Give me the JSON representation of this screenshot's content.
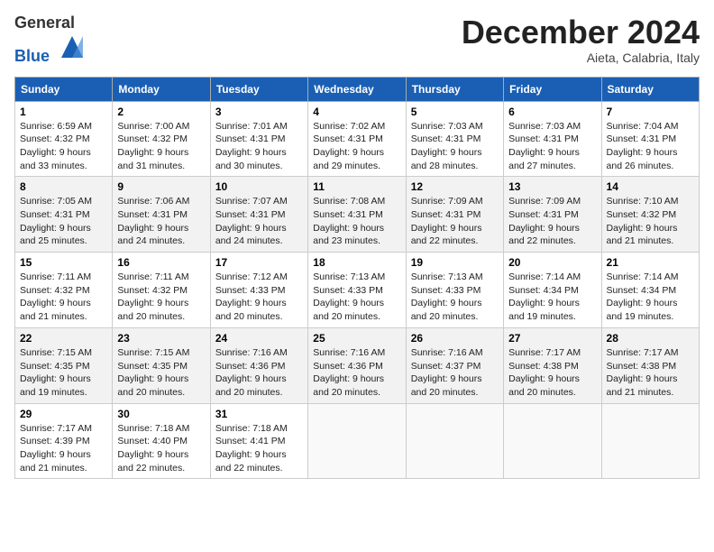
{
  "header": {
    "logo_line1": "General",
    "logo_line2": "Blue",
    "month_title": "December 2024",
    "location": "Aieta, Calabria, Italy"
  },
  "days_of_week": [
    "Sunday",
    "Monday",
    "Tuesday",
    "Wednesday",
    "Thursday",
    "Friday",
    "Saturday"
  ],
  "weeks": [
    [
      {
        "day": "1",
        "sunrise": "6:59 AM",
        "sunset": "4:32 PM",
        "daylight": "9 hours and 33 minutes."
      },
      {
        "day": "2",
        "sunrise": "7:00 AM",
        "sunset": "4:32 PM",
        "daylight": "9 hours and 31 minutes."
      },
      {
        "day": "3",
        "sunrise": "7:01 AM",
        "sunset": "4:31 PM",
        "daylight": "9 hours and 30 minutes."
      },
      {
        "day": "4",
        "sunrise": "7:02 AM",
        "sunset": "4:31 PM",
        "daylight": "9 hours and 29 minutes."
      },
      {
        "day": "5",
        "sunrise": "7:03 AM",
        "sunset": "4:31 PM",
        "daylight": "9 hours and 28 minutes."
      },
      {
        "day": "6",
        "sunrise": "7:03 AM",
        "sunset": "4:31 PM",
        "daylight": "9 hours and 27 minutes."
      },
      {
        "day": "7",
        "sunrise": "7:04 AM",
        "sunset": "4:31 PM",
        "daylight": "9 hours and 26 minutes."
      }
    ],
    [
      {
        "day": "8",
        "sunrise": "7:05 AM",
        "sunset": "4:31 PM",
        "daylight": "9 hours and 25 minutes."
      },
      {
        "day": "9",
        "sunrise": "7:06 AM",
        "sunset": "4:31 PM",
        "daylight": "9 hours and 24 minutes."
      },
      {
        "day": "10",
        "sunrise": "7:07 AM",
        "sunset": "4:31 PM",
        "daylight": "9 hours and 24 minutes."
      },
      {
        "day": "11",
        "sunrise": "7:08 AM",
        "sunset": "4:31 PM",
        "daylight": "9 hours and 23 minutes."
      },
      {
        "day": "12",
        "sunrise": "7:09 AM",
        "sunset": "4:31 PM",
        "daylight": "9 hours and 22 minutes."
      },
      {
        "day": "13",
        "sunrise": "7:09 AM",
        "sunset": "4:31 PM",
        "daylight": "9 hours and 22 minutes."
      },
      {
        "day": "14",
        "sunrise": "7:10 AM",
        "sunset": "4:32 PM",
        "daylight": "9 hours and 21 minutes."
      }
    ],
    [
      {
        "day": "15",
        "sunrise": "7:11 AM",
        "sunset": "4:32 PM",
        "daylight": "9 hours and 21 minutes."
      },
      {
        "day": "16",
        "sunrise": "7:11 AM",
        "sunset": "4:32 PM",
        "daylight": "9 hours and 20 minutes."
      },
      {
        "day": "17",
        "sunrise": "7:12 AM",
        "sunset": "4:33 PM",
        "daylight": "9 hours and 20 minutes."
      },
      {
        "day": "18",
        "sunrise": "7:13 AM",
        "sunset": "4:33 PM",
        "daylight": "9 hours and 20 minutes."
      },
      {
        "day": "19",
        "sunrise": "7:13 AM",
        "sunset": "4:33 PM",
        "daylight": "9 hours and 20 minutes."
      },
      {
        "day": "20",
        "sunrise": "7:14 AM",
        "sunset": "4:34 PM",
        "daylight": "9 hours and 19 minutes."
      },
      {
        "day": "21",
        "sunrise": "7:14 AM",
        "sunset": "4:34 PM",
        "daylight": "9 hours and 19 minutes."
      }
    ],
    [
      {
        "day": "22",
        "sunrise": "7:15 AM",
        "sunset": "4:35 PM",
        "daylight": "9 hours and 19 minutes."
      },
      {
        "day": "23",
        "sunrise": "7:15 AM",
        "sunset": "4:35 PM",
        "daylight": "9 hours and 20 minutes."
      },
      {
        "day": "24",
        "sunrise": "7:16 AM",
        "sunset": "4:36 PM",
        "daylight": "9 hours and 20 minutes."
      },
      {
        "day": "25",
        "sunrise": "7:16 AM",
        "sunset": "4:36 PM",
        "daylight": "9 hours and 20 minutes."
      },
      {
        "day": "26",
        "sunrise": "7:16 AM",
        "sunset": "4:37 PM",
        "daylight": "9 hours and 20 minutes."
      },
      {
        "day": "27",
        "sunrise": "7:17 AM",
        "sunset": "4:38 PM",
        "daylight": "9 hours and 20 minutes."
      },
      {
        "day": "28",
        "sunrise": "7:17 AM",
        "sunset": "4:38 PM",
        "daylight": "9 hours and 21 minutes."
      }
    ],
    [
      {
        "day": "29",
        "sunrise": "7:17 AM",
        "sunset": "4:39 PM",
        "daylight": "9 hours and 21 minutes."
      },
      {
        "day": "30",
        "sunrise": "7:18 AM",
        "sunset": "4:40 PM",
        "daylight": "9 hours and 22 minutes."
      },
      {
        "day": "31",
        "sunrise": "7:18 AM",
        "sunset": "4:41 PM",
        "daylight": "9 hours and 22 minutes."
      },
      null,
      null,
      null,
      null
    ]
  ],
  "labels": {
    "sunrise": "Sunrise:",
    "sunset": "Sunset:",
    "daylight": "Daylight:"
  }
}
